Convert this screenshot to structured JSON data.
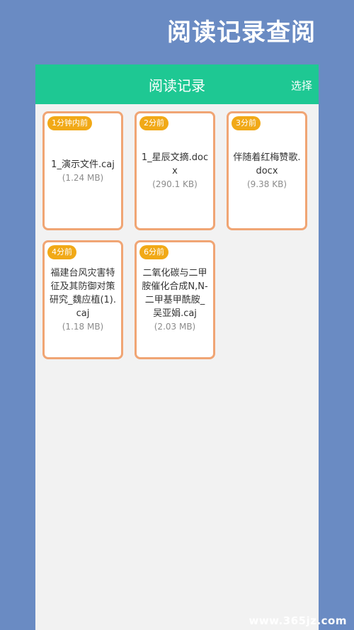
{
  "banner": {
    "title": "阅读记录查阅"
  },
  "header": {
    "title": "阅读记录",
    "action_label": "选择"
  },
  "records": [
    {
      "time": "1分钟内前",
      "name": "1_演示文件.caj",
      "size": "(1.24 MB)"
    },
    {
      "time": "2分前",
      "name": "1_星辰文摘.docx",
      "size": "(290.1 KB)"
    },
    {
      "time": "3分前",
      "name": "伴随着红梅赞歌.docx",
      "size": "(9.38 KB)"
    },
    {
      "time": "4分前",
      "name": "福建台风灾害特征及其防御对策研究_魏应植(1).caj",
      "size": "(1.18 MB)"
    },
    {
      "time": "6分前",
      "name": "二氧化碳与二甲胺催化合成N,N-二甲基甲酰胺_吴亚娟.caj",
      "size": "(2.03 MB)"
    }
  ],
  "watermark": {
    "text": "www.365jz.com"
  }
}
